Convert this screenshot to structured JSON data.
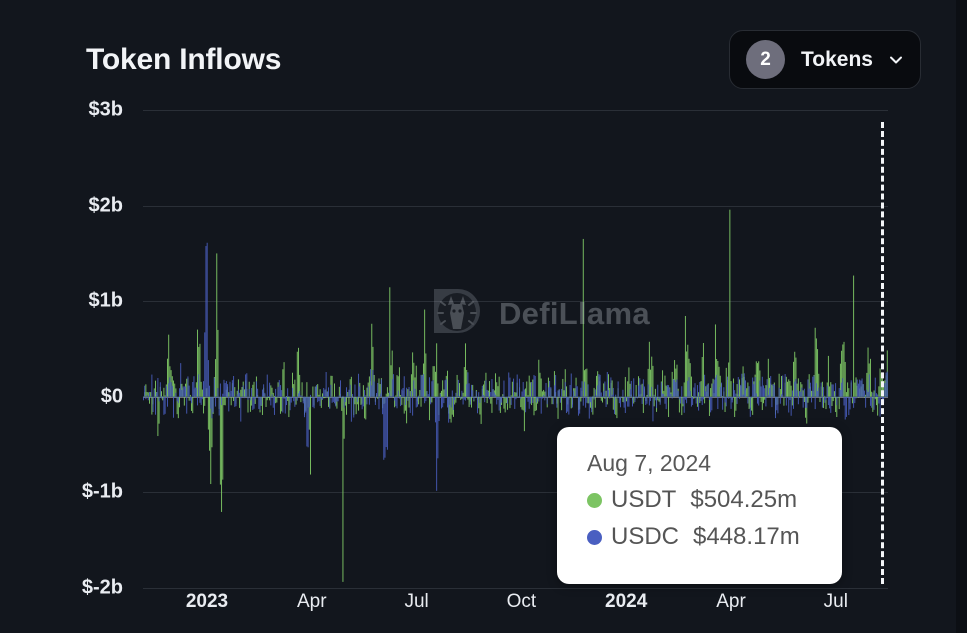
{
  "header": {
    "title": "Token Inflows"
  },
  "token_selector": {
    "count": "2",
    "label": "Tokens",
    "chevron_icon": "chevron-down-icon"
  },
  "watermark": {
    "text": "DefiLlama",
    "logo_icon": "defillama-llama-icon"
  },
  "tooltip": {
    "date": "Aug 7, 2024",
    "rows": [
      {
        "name": "USDT",
        "value": "$504.25m",
        "color": "#7cc463"
      },
      {
        "name": "USDC",
        "value": "$448.17m",
        "color": "#4a5fc1"
      }
    ]
  },
  "colors": {
    "background": "#12161d",
    "usdt": "#7cc463",
    "usdc": "#4a5fc1",
    "grid": "#2a2f37",
    "axis_text": "#e9ecf1",
    "crosshair": "#f3f5f8",
    "badge": "#6e6e7c"
  },
  "chart_data": {
    "type": "bar",
    "title": "Token Inflows",
    "xlabel": "",
    "ylabel": "",
    "ylim": [
      -2000000000,
      3000000000
    ],
    "ytick_labels": [
      "$3b",
      "$2b",
      "$1b",
      "$0",
      "$-1b",
      "$-2b"
    ],
    "ytick_values": [
      3000000000,
      2000000000,
      1000000000,
      0,
      -1000000000,
      -2000000000
    ],
    "xtick_labels": [
      "2023",
      "Apr",
      "Jul",
      "Oct",
      "2024",
      "Apr",
      "Jul"
    ],
    "xtick_major": [
      true,
      false,
      false,
      false,
      true,
      false,
      false
    ],
    "grid": true,
    "stacked": true,
    "legend": "none",
    "highlighted_x": "Aug 7, 2024",
    "series": [
      {
        "name": "USDT",
        "color": "#7cc463",
        "values": [
          -180,
          120,
          -60,
          90,
          -420,
          260,
          -140,
          980,
          70,
          -300,
          160,
          -90,
          420,
          -260,
          110,
          940,
          -180,
          230,
          -1300,
          70,
          1060,
          -1450,
          180,
          -90,
          240,
          -120,
          60,
          310,
          -200,
          90,
          -60,
          150,
          -330,
          80,
          -170,
          260,
          60,
          -110,
          430,
          -250,
          190,
          70,
          620,
          -140,
          80,
          -400,
          210,
          -60,
          140,
          90,
          -230,
          330,
          -80,
          160,
          -520,
          60,
          240,
          -130,
          70,
          180,
          -300,
          90,
          1050,
          -170,
          260,
          80,
          -140,
          620,
          -90,
          360,
          140,
          -240,
          80,
          520,
          170,
          -110,
          880,
          -300,
          250,
          640,
          -180,
          90,
          310,
          -420,
          60,
          180,
          -130,
          460,
          70,
          -90,
          240,
          -560,
          110,
          180,
          -80,
          330,
          140,
          -210,
          70,
          90,
          -140,
          260,
          60,
          -320,
          180,
          80,
          -110,
          420,
          90,
          -70,
          160,
          240,
          -180,
          60,
          330,
          -240,
          90,
          140,
          -70,
          520,
          180,
          -130,
          80,
          300,
          -180,
          70,
          240,
          90,
          -350,
          160,
          60,
          430,
          -90,
          180,
          230,
          -140,
          70,
          640,
          90,
          -210,
          310,
          150,
          -80,
          230,
          420,
          -160,
          90,
          580,
          240,
          -120,
          70,
          360,
          180,
          -240,
          90,
          470,
          130,
          -80,
          620,
          210,
          -160,
          90,
          340,
          180,
          -280,
          130,
          520,
          90,
          -70,
          410,
          160,
          -190,
          240,
          80,
          330,
          -140,
          510,
          90,
          260,
          -330,
          180,
          70,
          620,
          140,
          -90,
          360,
          230,
          -180,
          90,
          750,
          160,
          -120,
          410,
          240,
          -90,
          180,
          530,
          70,
          -240,
          320,
          140,
          504
        ]
      },
      {
        "name": "USDC",
        "color": "#4a5fc1",
        "values": [
          140,
          -90,
          220,
          -60,
          180,
          -310,
          90,
          260,
          -140,
          70,
          330,
          -180,
          120,
          -70,
          260,
          140,
          -90,
          2080,
          -240,
          130,
          -170,
          90,
          280,
          -120,
          60,
          190,
          -340,
          80,
          150,
          -90,
          230,
          70,
          -180,
          120,
          260,
          -140,
          90,
          310,
          -220,
          60,
          140,
          -90,
          180,
          230,
          -760,
          80,
          150,
          -120,
          90,
          260,
          -180,
          70,
          140,
          320,
          -90,
          180,
          -240,
          60,
          130,
          90,
          -170,
          240,
          380,
          -90,
          140,
          -1180,
          60,
          230,
          180,
          -120,
          90,
          260,
          -140,
          70,
          180,
          330,
          -90,
          120,
          240,
          -1280,
          70,
          160,
          -220,
          90,
          130,
          180,
          -70,
          240,
          90,
          -140,
          60,
          180,
          230,
          -90,
          140,
          -180,
          70,
          120,
          260,
          -90,
          180,
          60,
          140,
          -230,
          90,
          120,
          180,
          -70,
          240,
          90,
          -130,
          160,
          70,
          220,
          -90,
          140,
          180,
          -60,
          230,
          90,
          -140,
          120,
          70,
          180,
          -90,
          260,
          140,
          -70,
          90,
          180,
          -120,
          230,
          60,
          140,
          -90,
          180,
          120,
          -240,
          90,
          160,
          70,
          -130,
          220,
          90,
          180,
          -70,
          140,
          60,
          230,
          -120,
          90,
          180,
          -60,
          140,
          220,
          -90,
          70,
          160,
          120,
          -180,
          90,
          240,
          60,
          -140,
          180,
          90,
          120,
          -70,
          230,
          140,
          -90,
          60,
          180,
          120,
          -160,
          90,
          240,
          70,
          -120,
          180,
          140,
          -90,
          60,
          220,
          130,
          -70,
          180,
          90,
          140,
          -220,
          70,
          160,
          90,
          120,
          -180,
          240,
          70,
          140,
          -90,
          180,
          448
        ]
      }
    ]
  }
}
